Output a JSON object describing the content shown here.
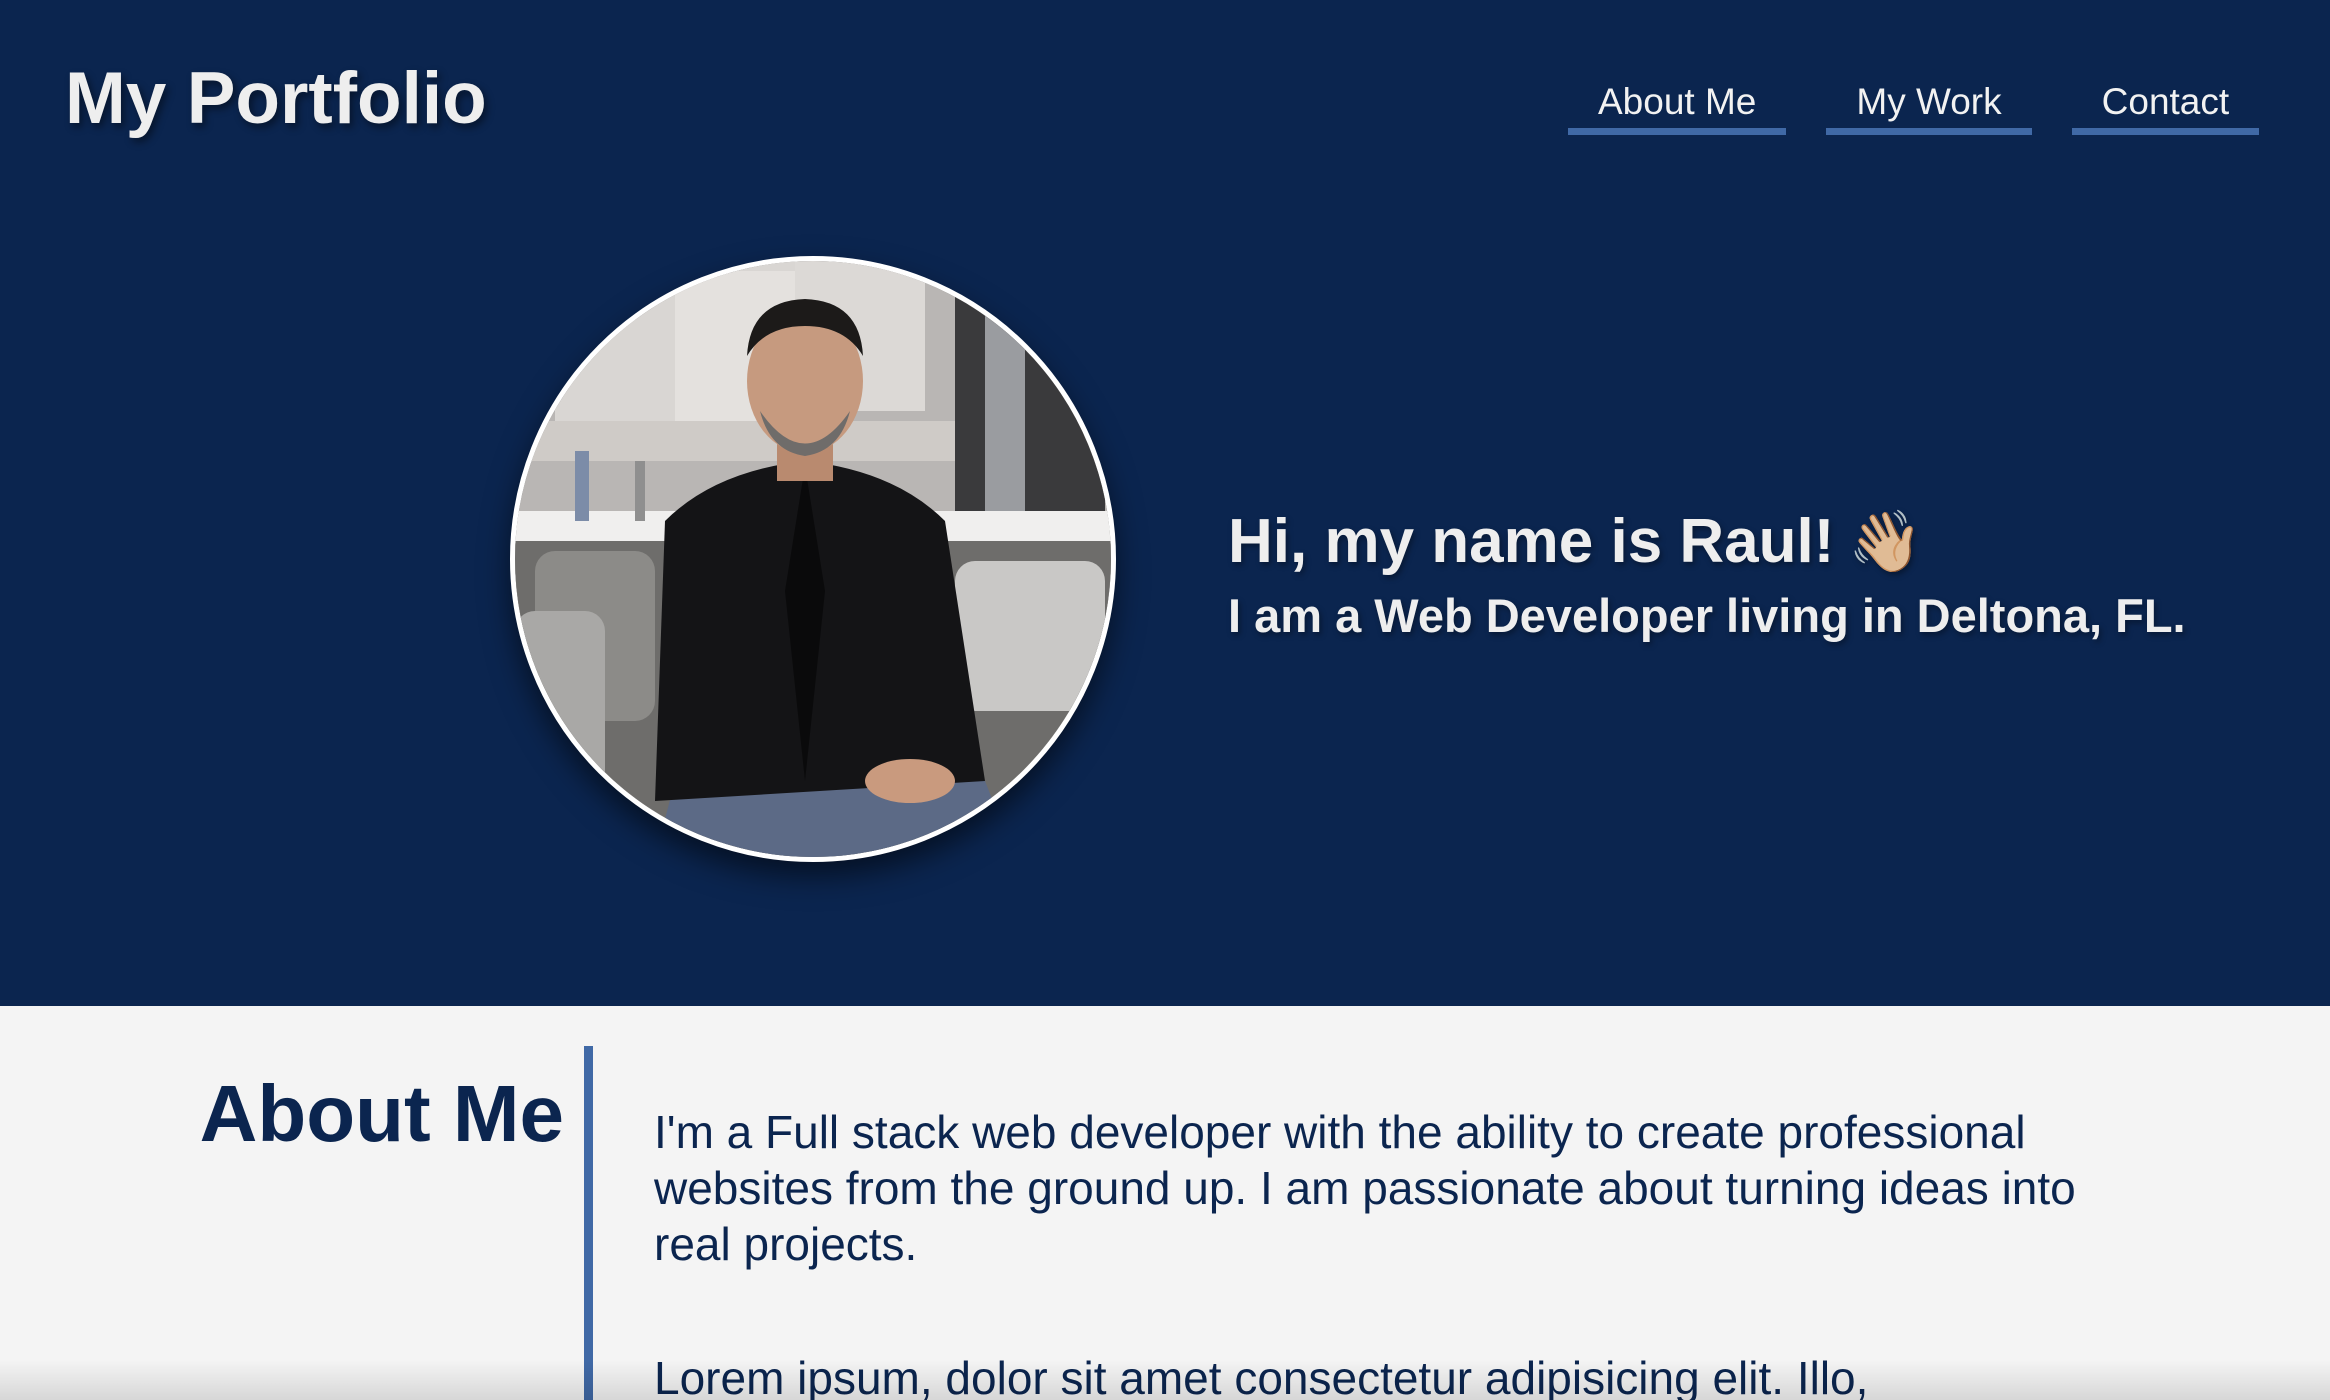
{
  "header": {
    "title": "My Portfolio",
    "nav": [
      {
        "label": "About Me"
      },
      {
        "label": "My Work"
      },
      {
        "label": "Contact"
      }
    ]
  },
  "hero": {
    "greeting": "Hi, my name is Raul!",
    "wave_emoji": "👋🏼",
    "tagline": "I am a Web Developer living in Deltona, FL.",
    "avatar_icon": "profile-photo"
  },
  "about": {
    "heading": "About Me",
    "paragraph_1": "I'm a Full stack web developer with the ability to create professional websites from the ground up. I am passionate about turning ideas into real projects.",
    "paragraph_2": "Lorem ipsum, dolor sit amet consectetur adipisicing elit. Illo,"
  },
  "colors": {
    "navy": "#0b254f",
    "accent": "#4069a6",
    "light_bg": "#f4f4f4",
    "text_light": "#eeeeee"
  }
}
